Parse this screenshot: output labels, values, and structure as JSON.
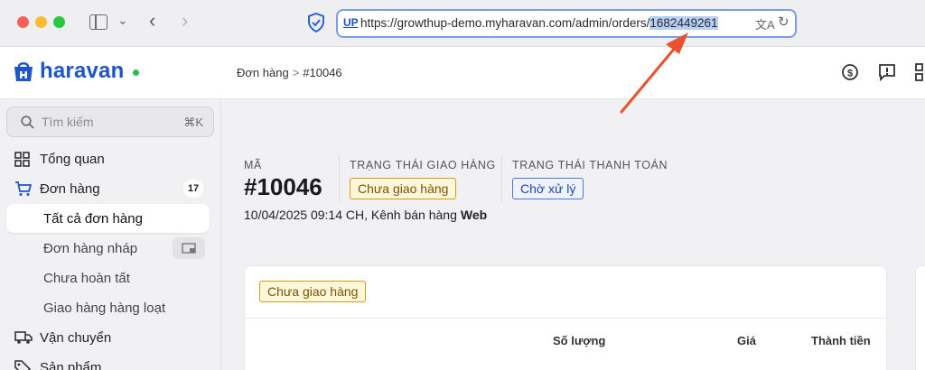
{
  "browser": {
    "url_prefix": "https://growthup-demo.myharavan.com/admin/orders/",
    "url_highlight": "1682449261",
    "url_badge": "UP"
  },
  "header": {
    "logo_text": "haravan",
    "breadcrumb_parent": "Đơn hàng",
    "breadcrumb_sep": ">",
    "breadcrumb_current": "#10046"
  },
  "sidebar": {
    "search_placeholder": "Tìm kiếm",
    "search_shortcut": "⌘K",
    "items": [
      {
        "label": "Tổng quan",
        "icon": "dashboard-icon"
      },
      {
        "label": "Đơn hàng",
        "icon": "cart-icon",
        "badge": "17"
      },
      {
        "label": "Vận chuyển",
        "icon": "truck-icon"
      },
      {
        "label": "Sản phẩm",
        "icon": "tag-icon"
      }
    ],
    "sub_items": [
      {
        "label": "Tất cả đơn hàng",
        "active": true
      },
      {
        "label": "Đơn hàng nháp"
      },
      {
        "label": "Chưa hoàn tất"
      },
      {
        "label": "Giao hàng hàng loạt"
      }
    ]
  },
  "order": {
    "code_label": "MÃ",
    "code": "#10046",
    "shipping_label": "TRẠNG THÁI GIAO HÀNG",
    "shipping_status": "Chưa giao hàng",
    "payment_label": "TRẠNG THÁI THANH TOÁN",
    "payment_status": "Chờ xử lý",
    "datetime_channel": "10/04/2025 09:14 CH, Kênh bán hàng",
    "channel": "Web"
  },
  "card": {
    "status": "Chưa giao hàng",
    "col_quantity": "Số lượng",
    "col_price": "Giá",
    "col_total": "Thành tiền"
  },
  "colors": {
    "brand": "#1e55c9",
    "annotation": "#e8532f"
  }
}
